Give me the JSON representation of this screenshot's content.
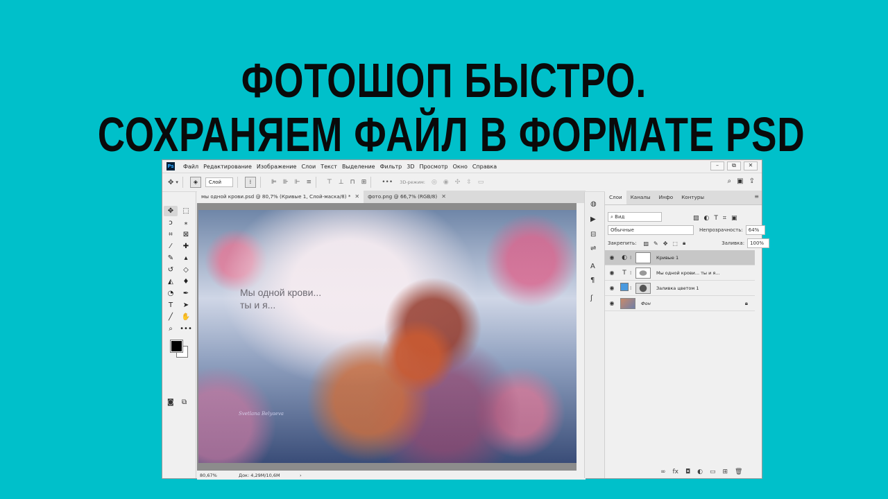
{
  "headline": {
    "line1": "ФОТОШОП БЫСТРО.",
    "line2": "СОХРАНЯЕМ ФАЙЛ В ФОРМАТЕ PSD"
  },
  "app": {
    "logo": "Ps",
    "menu": [
      "Файл",
      "Редактирование",
      "Изображение",
      "Слои",
      "Текст",
      "Выделение",
      "Фильтр",
      "3D",
      "Просмотр",
      "Окно",
      "Справка"
    ],
    "window_buttons": [
      "–",
      "⧉",
      "✕"
    ]
  },
  "options_bar": {
    "layer_select": "Слой",
    "mode_3d": "3D-режим:"
  },
  "tabs": [
    {
      "label": "мы одной крови.psd @ 80,7% (Кривые 1, Слой-маска/8) *",
      "close": "✕"
    },
    {
      "label": "фото.png @ 66,7% (RGB/8)",
      "close": "✕"
    }
  ],
  "canvas": {
    "caption": "Мы одной крови...\nты и я...",
    "signature": "Svetlana Belyaeva"
  },
  "status": {
    "zoom": "80,67%",
    "doc": "Док: 4,29M/10,6M",
    "arrow": "›"
  },
  "layers_panel": {
    "tabs": [
      "Слои",
      "Каналы",
      "Инфо",
      "Контуры"
    ],
    "filter_kind": "Вид",
    "blend_mode": "Обычные",
    "opacity_label": "Непрозрачность:",
    "opacity_value": "64%",
    "lock_label": "Закрепить:",
    "fill_label": "Заливка:",
    "fill_value": "100%",
    "layers": [
      {
        "name": "Кривые 1",
        "type": "◐",
        "selected": true
      },
      {
        "name": "Мы одной крови... ты и я...",
        "type": "T",
        "selected": false
      },
      {
        "name": "Заливка цветом 1",
        "type": "",
        "selected": false
      },
      {
        "name": "Фон",
        "type": "",
        "selected": false,
        "locked": true
      }
    ]
  },
  "colors": {
    "background": "#00c0ca",
    "fg_swatch": "#000000",
    "bg_swatch": "#ffffff",
    "fill_layer": "#4a9ae0"
  }
}
